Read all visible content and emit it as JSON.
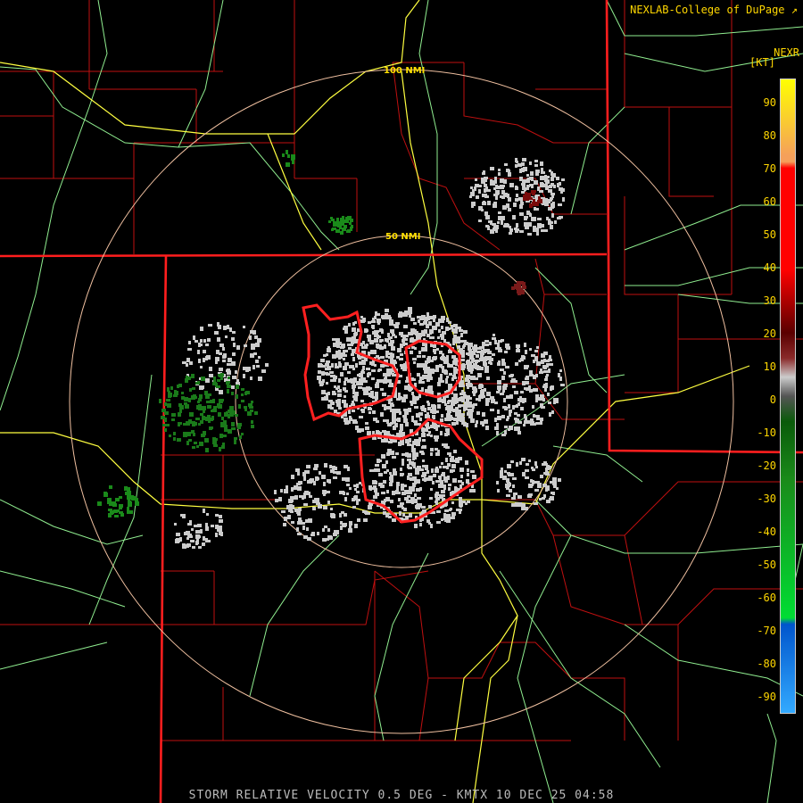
{
  "header": {
    "credit": "NEXLAB-College of DuPage",
    "product_code": "NEXR",
    "unit": "[KT]"
  },
  "caption": "STORM RELATIVE VELOCITY 0.5 DEG - KMTX 10 DEC 25 04:58",
  "rings": [
    {
      "label": "100 NMI"
    },
    {
      "label": "50 NMI"
    }
  ],
  "colorbar": {
    "ticks": [
      "90",
      "80",
      "70",
      "60",
      "50",
      "40",
      "30",
      "20",
      "10",
      "0",
      "-10",
      "-20",
      "-30",
      "-40",
      "-50",
      "-60",
      "-70",
      "-80",
      "-90"
    ],
    "colors": {
      "positive_high": "#ffff00",
      "positive_orange": "#f5a05a",
      "positive_red": "#ff0000",
      "positive_dark": "#5a0000",
      "neutral": "#cccccc",
      "negative_dark": "#0a5a0a",
      "negative_green": "#00dd33",
      "negative_blue": "#0055cc",
      "negative_cyan": "#33aaff"
    }
  },
  "map_colors": {
    "state_border": "#ff1e1e",
    "county_border": "#c01010",
    "highway": "#ffff40",
    "road": "#90ee90",
    "warning": "#ff2020",
    "range_ring": "#f0c0a0"
  }
}
